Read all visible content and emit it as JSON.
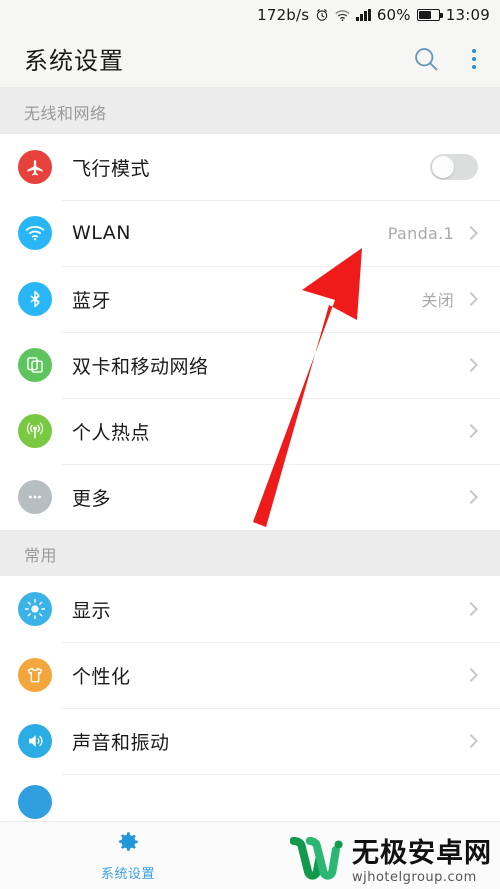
{
  "status_bar": {
    "network_speed": "172b/s",
    "alarm_icon": "alarm-clock-icon",
    "wifi_icon": "wifi-icon",
    "signal_icon": "cellular-signal-icon",
    "battery_percent": "60%",
    "battery_level": 60,
    "clock": "13:09"
  },
  "app_bar": {
    "title": "系统设置",
    "search_icon": "search-icon",
    "overflow_icon": "overflow-menu-icon",
    "accent": "#2196d8"
  },
  "sections": [
    {
      "header": "无线和网络",
      "rows": [
        {
          "label": "飞行模式",
          "value": "",
          "icon": "airplane-icon",
          "icon_color": "#e8403a",
          "control": "toggle",
          "toggle_on": false
        },
        {
          "label": "WLAN",
          "value": "Panda.1",
          "icon": "wifi-icon",
          "icon_color": "#29b6f6",
          "control": "chevron"
        },
        {
          "label": "蓝牙",
          "value": "关闭",
          "icon": "bluetooth-icon",
          "icon_color": "#29b6f6",
          "control": "chevron"
        },
        {
          "label": "双卡和移动网络",
          "value": "",
          "icon": "sim-cards-icon",
          "icon_color": "#5ec45e",
          "control": "chevron"
        },
        {
          "label": "个人热点",
          "value": "",
          "icon": "hotspot-icon",
          "icon_color": "#7ac943",
          "control": "chevron"
        },
        {
          "label": "更多",
          "value": "",
          "icon": "ellipsis-icon",
          "icon_color": "#b6bec2",
          "control": "chevron"
        }
      ]
    },
    {
      "header": "常用",
      "rows": [
        {
          "label": "显示",
          "value": "",
          "icon": "brightness-icon",
          "icon_color": "#3bb3e8",
          "control": "chevron"
        },
        {
          "label": "个性化",
          "value": "",
          "icon": "tshirt-icon",
          "icon_color": "#f2a63b",
          "control": "chevron"
        },
        {
          "label": "声音和振动",
          "value": "",
          "icon": "speaker-icon",
          "icon_color": "#29ade4",
          "control": "chevron"
        }
      ]
    }
  ],
  "annotation": {
    "type": "red-arrow",
    "color": "#ef1b1b",
    "points_to": "WLAN"
  },
  "bottom_bar": {
    "nav_label": "系统设置",
    "nav_icon": "gear-icon",
    "nav_color": "#2196d8"
  },
  "watermark": {
    "title": "无极安卓网",
    "url": "wjhotelgroup.com",
    "logo": "w-logo",
    "logo_color": "#119a4e"
  }
}
